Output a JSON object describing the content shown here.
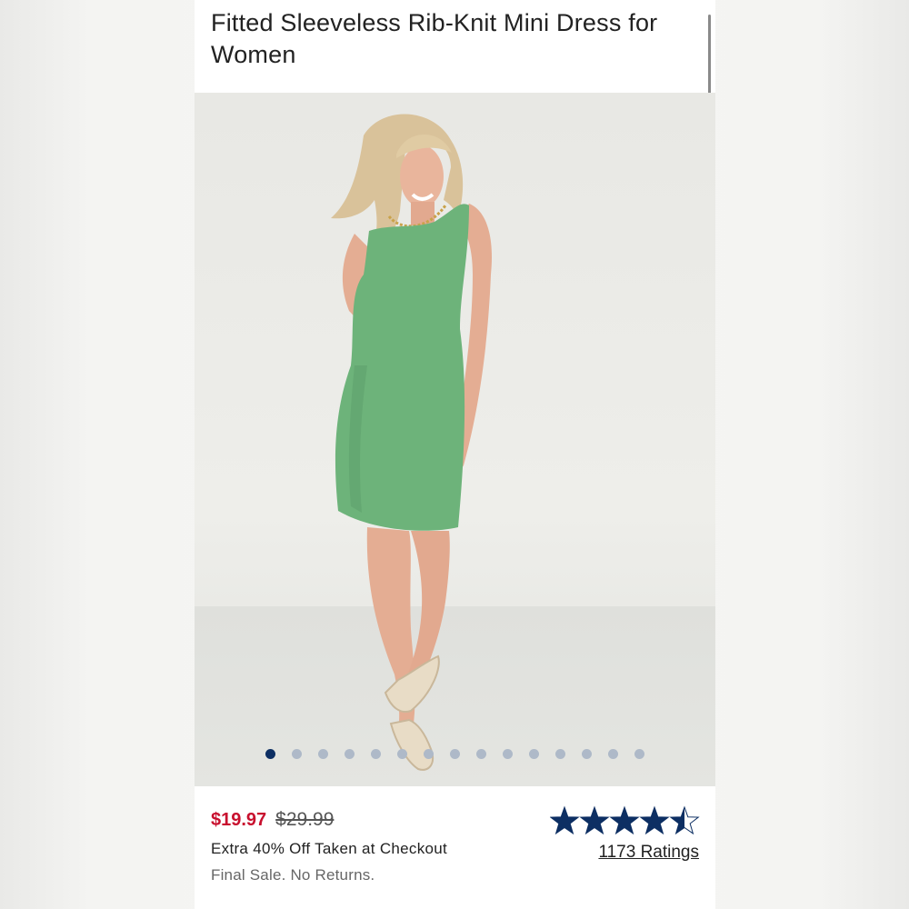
{
  "product": {
    "title": "Fitted Sleeveless Rib-Knit Mini Dress for Women",
    "image_alt_name": "model-photo",
    "carousel": {
      "total_images": 15,
      "active_index": 0
    },
    "pricing": {
      "sale_price": "$19.97",
      "original_price": "$29.99",
      "promo_text": "Extra 40% Off Taken at Checkout",
      "sale_note": "Final Sale. No Returns."
    },
    "rating": {
      "stars_value": 4.5,
      "stars_max": 5,
      "ratings_label": "1173 Ratings"
    }
  },
  "colors": {
    "sale_red": "#c8102e",
    "star_navy": "#0d2f63",
    "dress_green": "#6db37a",
    "dot_inactive": "#aeb9c8"
  }
}
